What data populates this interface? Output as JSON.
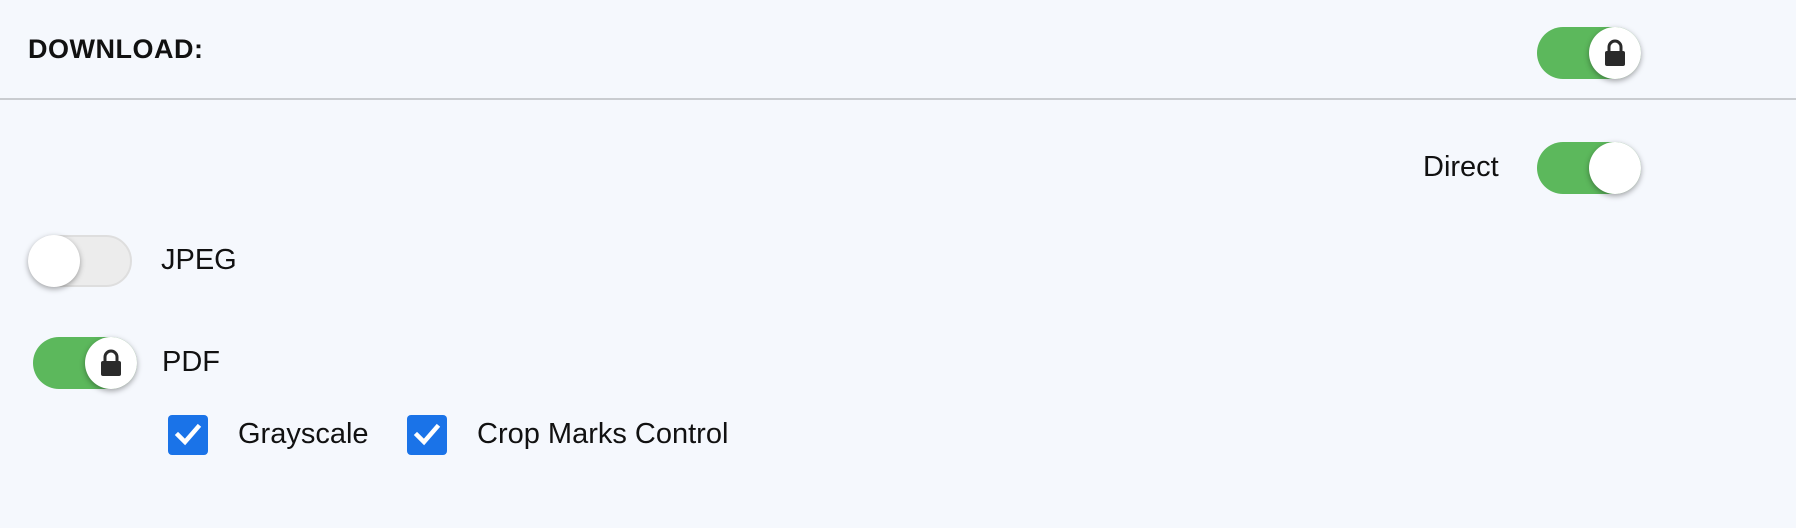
{
  "header": {
    "title": "DOWNLOAD:",
    "master_toggle": {
      "state": "on",
      "locked": true,
      "icon": "lock-icon"
    }
  },
  "options": {
    "direct": {
      "label": "Direct",
      "state": "on",
      "locked": false
    },
    "jpeg": {
      "label": "JPEG",
      "state": "off",
      "locked": false
    },
    "pdf": {
      "label": "PDF",
      "state": "on",
      "locked": true,
      "icon": "lock-icon",
      "sub_options": [
        {
          "label": "Grayscale",
          "checked": true
        },
        {
          "label": "Crop Marks Control",
          "checked": true
        }
      ]
    }
  },
  "colors": {
    "toggle_on": "#5cb85c",
    "toggle_off": "#ececec",
    "checkbox": "#1a73e8",
    "background": "#f5f8fd",
    "divider": "#c9ccd0"
  }
}
